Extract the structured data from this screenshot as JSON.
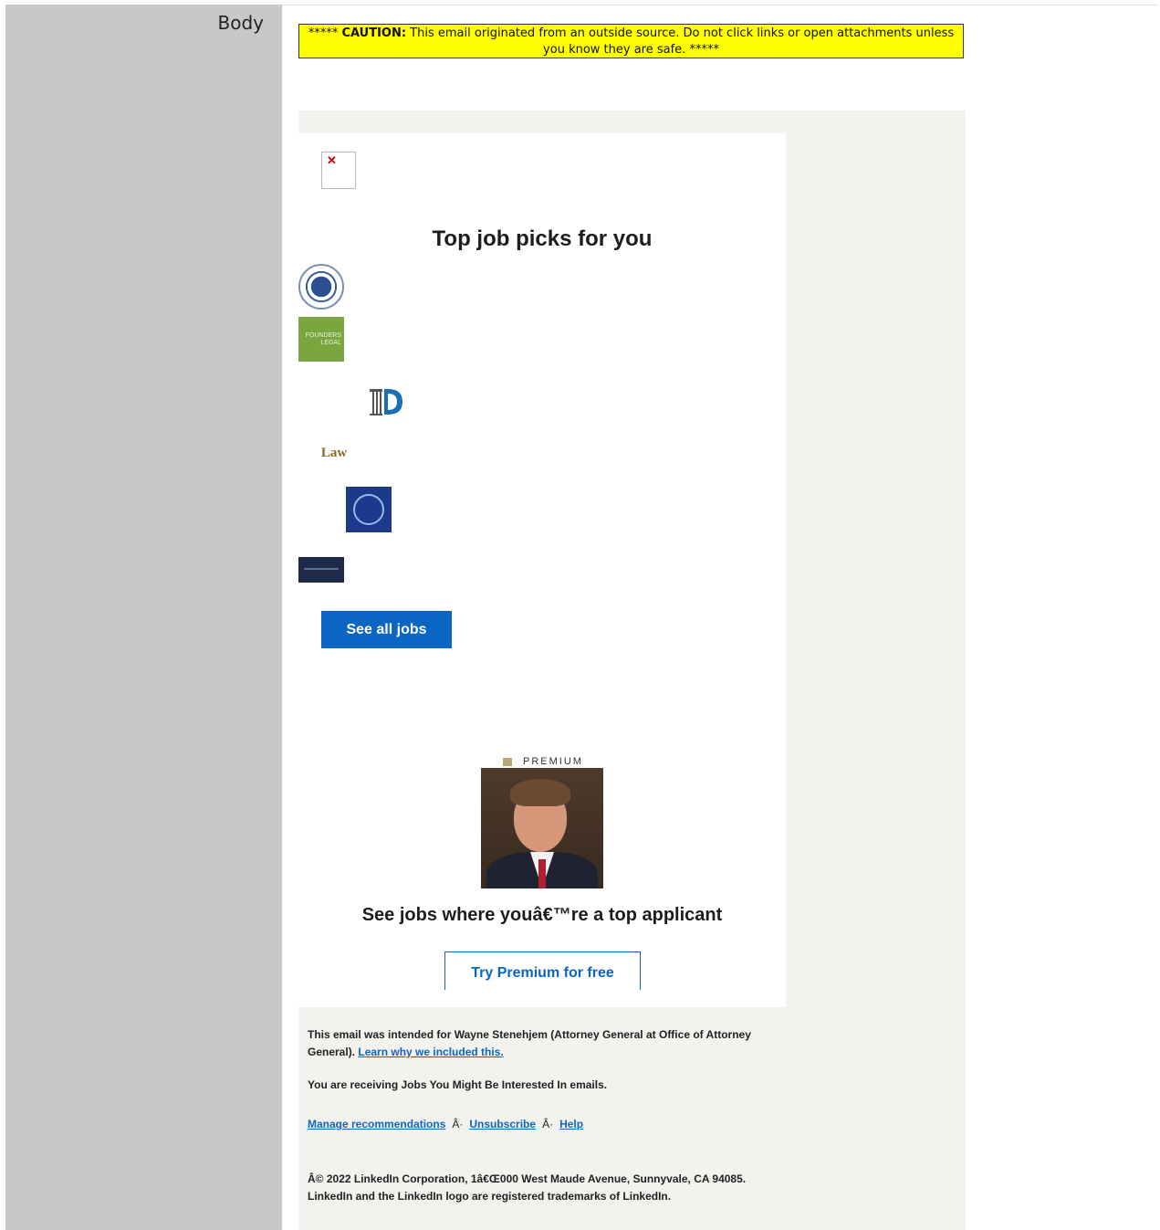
{
  "sidebar": {
    "label": "Body"
  },
  "caution": {
    "stars_prefix": "***** ",
    "label": "CAUTION:",
    "text": " This email originated from an outside source. Do not click links or open attachments unless you know they are safe. *****"
  },
  "email": {
    "broken_image_glyph": "✕",
    "headline": "Top job picks for you",
    "logos": [
      {
        "name": "dhs-seal-icon"
      },
      {
        "name": "founders-legal-logo",
        "text": "FOUNDERS LEGAL"
      },
      {
        "name": "d-column-logo"
      },
      {
        "name": "law-logo",
        "text": "Law"
      },
      {
        "name": "eagle-seal-logo"
      },
      {
        "name": "dark-banner-logo"
      }
    ],
    "see_all_jobs_label": "See all jobs",
    "premium_label": "PREMIUM",
    "premium_headline": "See jobs where youâ€™re a top applicant",
    "try_premium_label": "Try Premium for free",
    "colors": {
      "brand_blue": "#0a66c2",
      "caution_yellow": "#ffff00",
      "premium_gold": "#b8a772"
    }
  },
  "footer": {
    "intended_text": "This email was intended for Wayne Stenehjem (Attorney General at Office of Attorney General). ",
    "learn_why_link": "Learn why we included this.",
    "receiving_text": "You are receiving Jobs You Might Be Interested In emails.",
    "manage_link": "Manage recommendations",
    "separator": "Â·",
    "unsubscribe_link": "Unsubscribe",
    "help_link": "Help",
    "copyright_text": "Â© 2022 LinkedIn Corporation, 1â€Œ000 West Maude Avenue, Sunnyvale, CA 94085. LinkedIn and the LinkedIn logo are registered trademarks of LinkedIn."
  }
}
